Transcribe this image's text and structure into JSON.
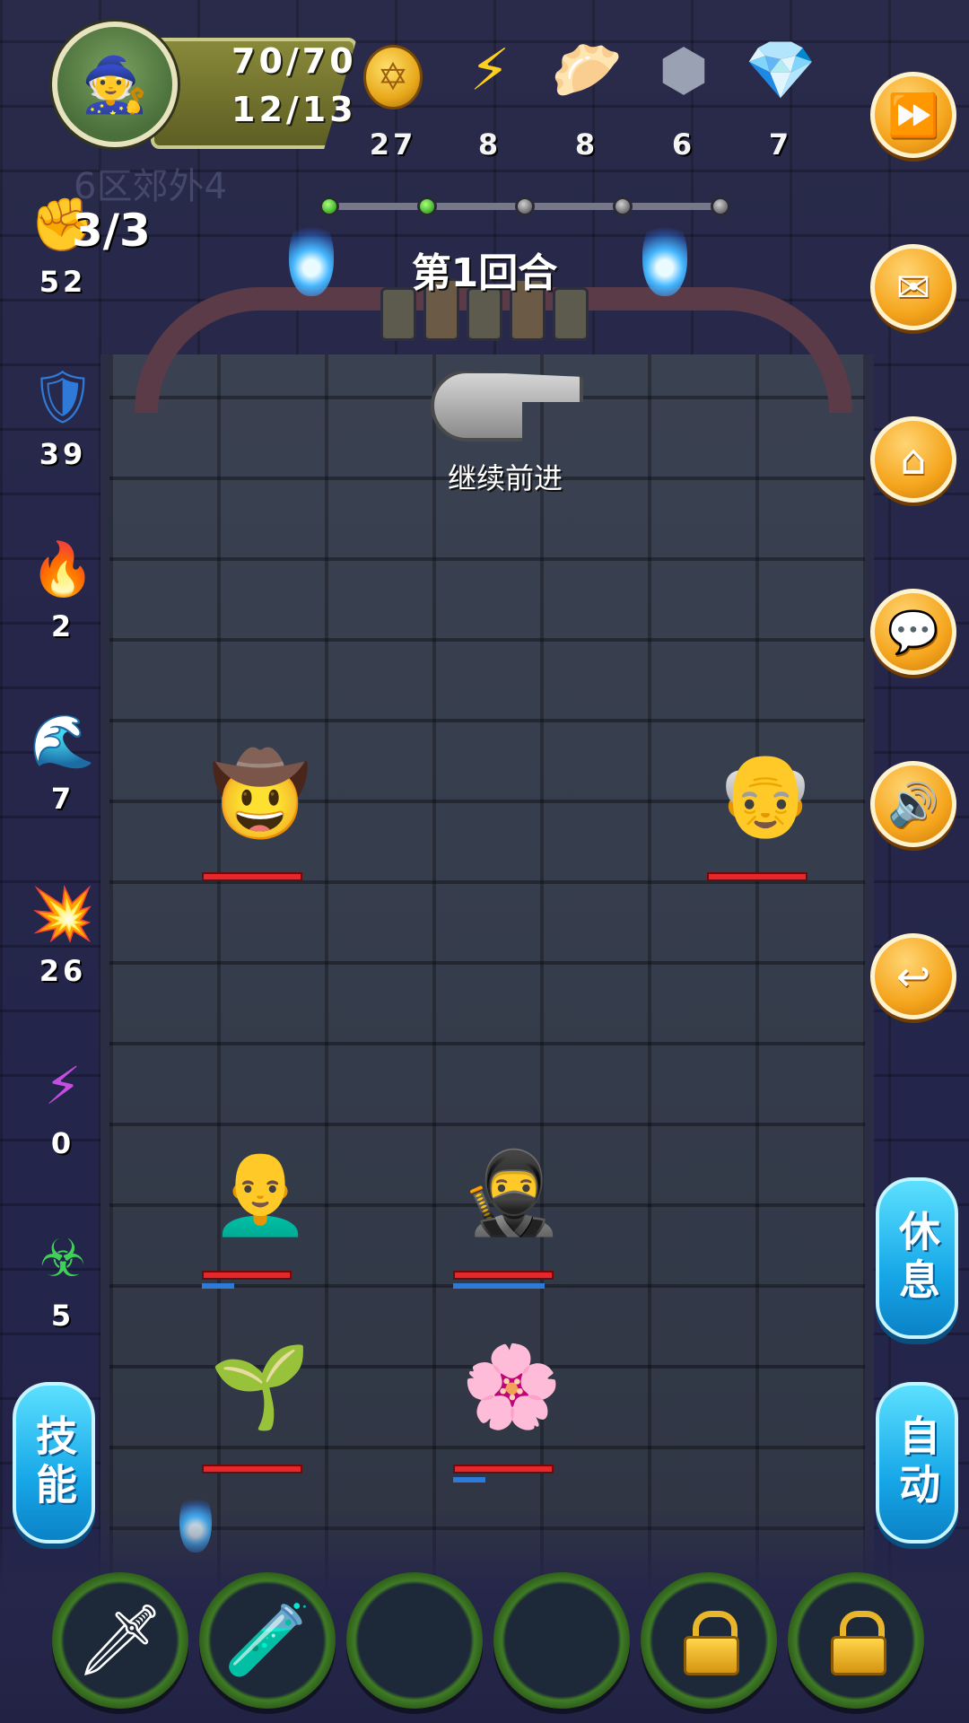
{
  "player": {
    "hp": "70/70",
    "level_progress": "12/13",
    "avatar_icon": "wizard-hat-avatar"
  },
  "zone": {
    "name": "6区郊外4"
  },
  "resources": [
    {
      "name": "gold-coin-icon",
      "count": "27"
    },
    {
      "name": "energy-bolt-icon",
      "count": "8"
    },
    {
      "name": "dumpling-icon",
      "count": "8"
    },
    {
      "name": "iron-ingot-icon",
      "count": "6"
    },
    {
      "name": "purple-crystal-icon",
      "count": "7"
    }
  ],
  "progress": {
    "completed_nodes": 2,
    "total_nodes": 5
  },
  "round": {
    "label": "第1回合"
  },
  "pointer": {
    "label": "继续前进"
  },
  "stats": {
    "fist": {
      "count": "3/3",
      "value": "52"
    },
    "shield": {
      "value": "39"
    },
    "light": {
      "value": "2"
    },
    "water": {
      "value": "7"
    },
    "fire": {
      "value": "26"
    },
    "dark": {
      "value": "0"
    },
    "poison": {
      "value": "5"
    }
  },
  "side_buttons": {
    "rest": "休息",
    "skill": "技能",
    "auto": "自动"
  },
  "menu_buttons": [
    "fast-forward",
    "mail",
    "home",
    "chat",
    "sound",
    "back"
  ],
  "units": {
    "enemies": [
      {
        "name": "treasure-hunter",
        "hp_pct": 100
      },
      {
        "name": "old-farmer",
        "hp_pct": 100
      }
    ],
    "allies": [
      {
        "name": "bald-monk",
        "hp_pct": 100,
        "mp_pct": 30
      },
      {
        "name": "hero-swordsman",
        "hp_pct": 100,
        "mp_pct": 90
      },
      {
        "name": "seedling-pet",
        "hp_pct": 100
      },
      {
        "name": "purple-flower-pet",
        "hp_pct": 100,
        "mp_pct": 30
      }
    ]
  },
  "skill_slots": [
    {
      "icon": "sword-icon",
      "locked": false
    },
    {
      "icon": "potion-icon",
      "locked": false
    },
    {
      "icon": "",
      "locked": false
    },
    {
      "icon": "",
      "locked": false
    },
    {
      "icon": "lock-icon",
      "locked": true
    },
    {
      "icon": "lock-icon",
      "locked": true
    }
  ],
  "colors": {
    "hp_bar": "#e5282c",
    "mp_bar": "#2f7ad9",
    "menu_button": "#f5a51c",
    "side_button": "#17a8e8"
  }
}
